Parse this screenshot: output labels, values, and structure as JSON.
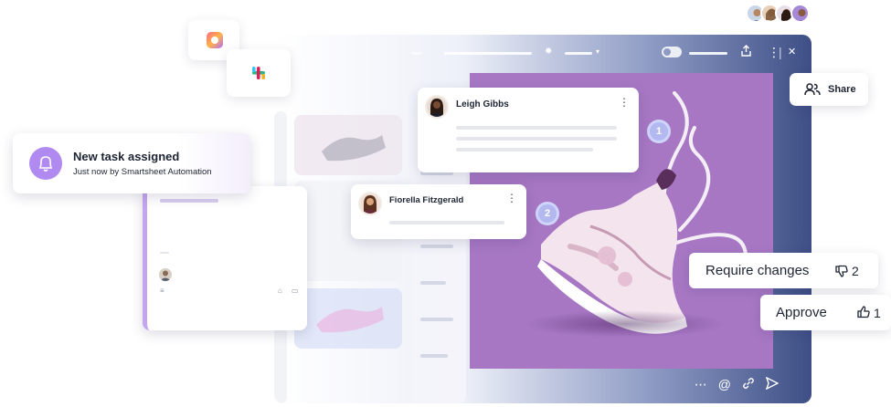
{
  "notification": {
    "title": "New task assigned",
    "subtitle": "Just now by Smartsheet Automation",
    "icon": "bell-icon",
    "accent": "#b08af0"
  },
  "share_button": {
    "label": "Share",
    "icon": "users-icon"
  },
  "comments": [
    {
      "author": "Leigh Gibbs",
      "pin": "1"
    },
    {
      "author": "Fiorella Fitzgerald",
      "pin": "2"
    }
  ],
  "review_actions": {
    "require_changes": {
      "label": "Require changes",
      "count": "2",
      "icon": "thumbs-down-icon"
    },
    "approve": {
      "label": "Approve",
      "count": "1",
      "icon": "thumbs-up-icon"
    }
  },
  "canvas": {
    "background": "#a777c4"
  },
  "bottom_toolbar": [
    "more-icon",
    "mention-icon",
    "link-icon",
    "send-icon"
  ],
  "collaborators": [
    "avatar-1",
    "avatar-2",
    "avatar-3",
    "avatar-4"
  ],
  "app_tiles": [
    "photos-app-icon",
    "slack-icon"
  ]
}
